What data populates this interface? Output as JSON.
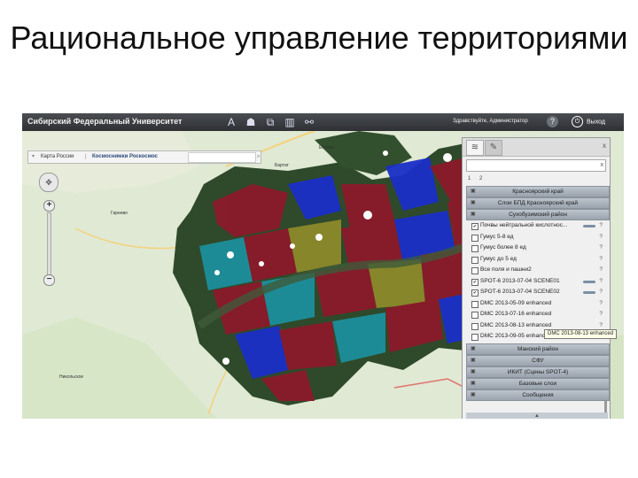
{
  "slide": {
    "title": "Рациональное управление территориями"
  },
  "colors": {
    "topbar": "#3a3d42",
    "polygon_red": "#8b1a2b",
    "polygon_blue": "#1a2fc8",
    "polygon_teal": "#1d8f9c",
    "polygon_olive": "#8c8a2a",
    "forest": "#2f4a2a"
  },
  "app": {
    "title": "Сибирский Федеральный Университет",
    "greeting": "Здравствуйте, Администратор",
    "help": "?",
    "logout": "Выход",
    "toolbar_icons": [
      "tool-a-icon",
      "user-icon",
      "plugin-icon",
      "chart-icon",
      "share-icon"
    ]
  },
  "map": {
    "search_bar": {
      "item1": "Карта России",
      "item2": "Космоснимки Роскосмос"
    },
    "labels": {
      "elovka": "Еловка",
      "bartat": "Бартат",
      "gareevo": "Гареево",
      "nikolskoe": "Никольское"
    }
  },
  "panel": {
    "tab_layers_icon": "layers-icon",
    "tab_edit_icon": "pencil-icon",
    "close": "x",
    "pages": [
      "1",
      "2"
    ],
    "groups_top": [
      "Красноярский край",
      "Слои БПД Красноярский край",
      "Сухобузимский район"
    ],
    "layers": [
      {
        "name": "Почвы нейтральной кислотнос...",
        "checked": true,
        "slider": true
      },
      {
        "name": "Гумус 5-8 ед",
        "checked": false,
        "slider": false
      },
      {
        "name": "Гумус более 8 ед",
        "checked": false,
        "slider": false
      },
      {
        "name": "Гумус до 5 ед",
        "checked": false,
        "slider": false
      },
      {
        "name": "Все поля и пашни2",
        "checked": false,
        "slider": false
      },
      {
        "name": "SPOT-6 2013-07-04 SCENE01",
        "checked": true,
        "slider": true
      },
      {
        "name": "SPOT-6 2013-07-04 SCENE02",
        "checked": true,
        "slider": true
      },
      {
        "name": "DMC 2013-05-09 enhanced",
        "checked": false,
        "slider": false
      },
      {
        "name": "DMC 2013-07-16 enhanced",
        "checked": false,
        "slider": false
      },
      {
        "name": "DMC 2013-08-13 enhanced",
        "checked": false,
        "slider": false
      },
      {
        "name": "DMC 2013-09-05 enhanced",
        "checked": false,
        "slider": false
      }
    ],
    "help_mark": "?",
    "tooltip": "DMC 2013-08-13 enhanced",
    "groups_bottom": [
      "Манский район",
      "СФУ",
      "ИКИТ (Сцены SPOT-4)",
      "Базовые слои",
      "Сообщения"
    ]
  }
}
